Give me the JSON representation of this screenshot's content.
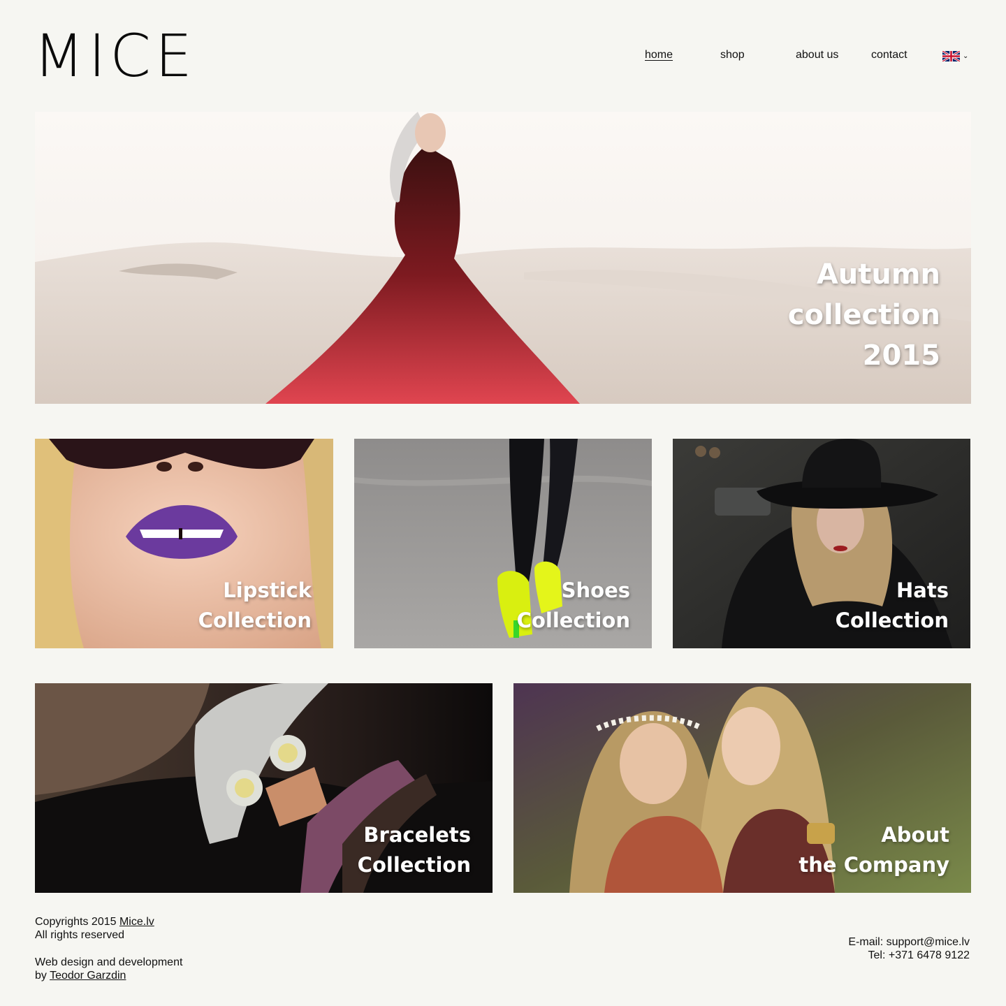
{
  "brand": {
    "logo": "MICE"
  },
  "nav": {
    "items": [
      {
        "label": "home",
        "active": true
      },
      {
        "label": "shop"
      },
      {
        "label": "about us"
      },
      {
        "label": "contact"
      }
    ],
    "language_icon": "uk-flag-icon"
  },
  "hero": {
    "lines": [
      "Autumn",
      "collection",
      "2015"
    ]
  },
  "tiles": [
    {
      "lines": [
        "Lipstick",
        "Collection"
      ]
    },
    {
      "lines": [
        "Shoes",
        "Collection"
      ]
    },
    {
      "lines": [
        "Hats",
        "Collection"
      ]
    },
    {
      "lines": [
        "Bracelets",
        "Collection"
      ]
    },
    {
      "lines": [
        "About",
        "the Company"
      ]
    }
  ],
  "footer": {
    "copyright_prefix": "Copyrights 2015 ",
    "copyright_link": "Mice.lv",
    "rights": "All rights reserved",
    "credit_line": "Web design and development",
    "credit_by": "by ",
    "credit_link": "Teodor Garzdin",
    "email": "E-mail: support@mice.lv",
    "tel": "Tel: +371 6478 9122"
  },
  "colors": {
    "background": "#f6f6f2",
    "text": "#111111",
    "caption": "#ffffff"
  }
}
